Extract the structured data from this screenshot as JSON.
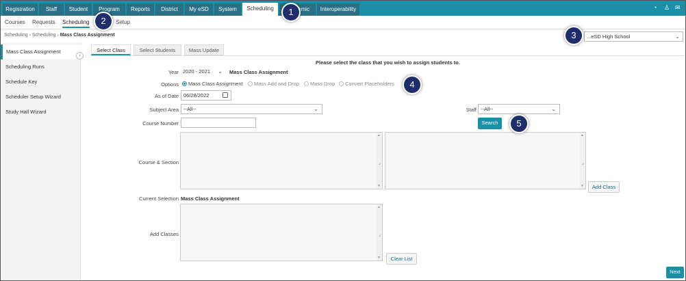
{
  "top_nav": {
    "tabs": [
      {
        "label": "Registration"
      },
      {
        "label": "Staff"
      },
      {
        "label": "Student"
      },
      {
        "label": "Program"
      },
      {
        "label": "Reports"
      },
      {
        "label": "District"
      },
      {
        "label": "My eSD"
      },
      {
        "label": "System"
      },
      {
        "label": "Scheduling"
      },
      {
        "label": "Academic"
      },
      {
        "label": "Interoperability"
      }
    ],
    "active": "Scheduling",
    "icons": [
      "dashboard-icon",
      "user-icon",
      "mail-icon"
    ]
  },
  "sub_nav": {
    "tabs": [
      {
        "label": "Courses"
      },
      {
        "label": "Requests"
      },
      {
        "label": "Scheduling"
      },
      {
        "label": "Setup"
      }
    ],
    "active": "Scheduling"
  },
  "breadcrumb": {
    "items": [
      "Scheduling",
      "Scheduling"
    ],
    "current": "Mass Class Assignment"
  },
  "school_select": {
    "value": "...eSD High School"
  },
  "sidebar": {
    "items": [
      {
        "label": "Mass Class Assignment"
      },
      {
        "label": "Scheduling Runs"
      },
      {
        "label": "Schedule Key"
      },
      {
        "label": "Scheduler Setup Wizard"
      },
      {
        "label": "Study Hall Wizard"
      }
    ],
    "active": "Mass Class Assignment"
  },
  "content_tabs": [
    {
      "label": "Select Class"
    },
    {
      "label": "Select Students"
    },
    {
      "label": "Mass Update"
    }
  ],
  "instruction": "Please select the class that you wish to assign students to.",
  "form": {
    "year_label": "Year",
    "year_value": "2020 - 2021",
    "year_title": "Mass Class Assignment",
    "options_label": "Options",
    "options": [
      {
        "label": "Mass Class Assignment",
        "selected": true
      },
      {
        "label": "Mass Add and Drop",
        "selected": false
      },
      {
        "label": "Mass Drop",
        "selected": false
      },
      {
        "label": "Convert Placeholders",
        "selected": false
      }
    ],
    "as_of_date_label": "As of Date",
    "as_of_date_value": "06/28/2022",
    "subject_area_label": "Subject Area",
    "subject_area_value": "--All--",
    "staff_label": "Staff",
    "staff_value": "--All--",
    "course_number_label": "Course Number",
    "course_number_value": "",
    "search_button": "Search",
    "course_section_label": "Course & Section",
    "add_class_button": "Add Class",
    "current_selection_label": "Current Selection",
    "current_selection_value": "Mass Class Assignment",
    "add_classes_label": "Add Classes",
    "clear_list_button": "Clear List",
    "next_button": "Next"
  },
  "callouts": [
    "1",
    "2",
    "3",
    "4",
    "5"
  ],
  "colors": {
    "accent": "#1a8fa6",
    "nav_tab": "#2a6f86",
    "callout": "#1f2d6b"
  }
}
